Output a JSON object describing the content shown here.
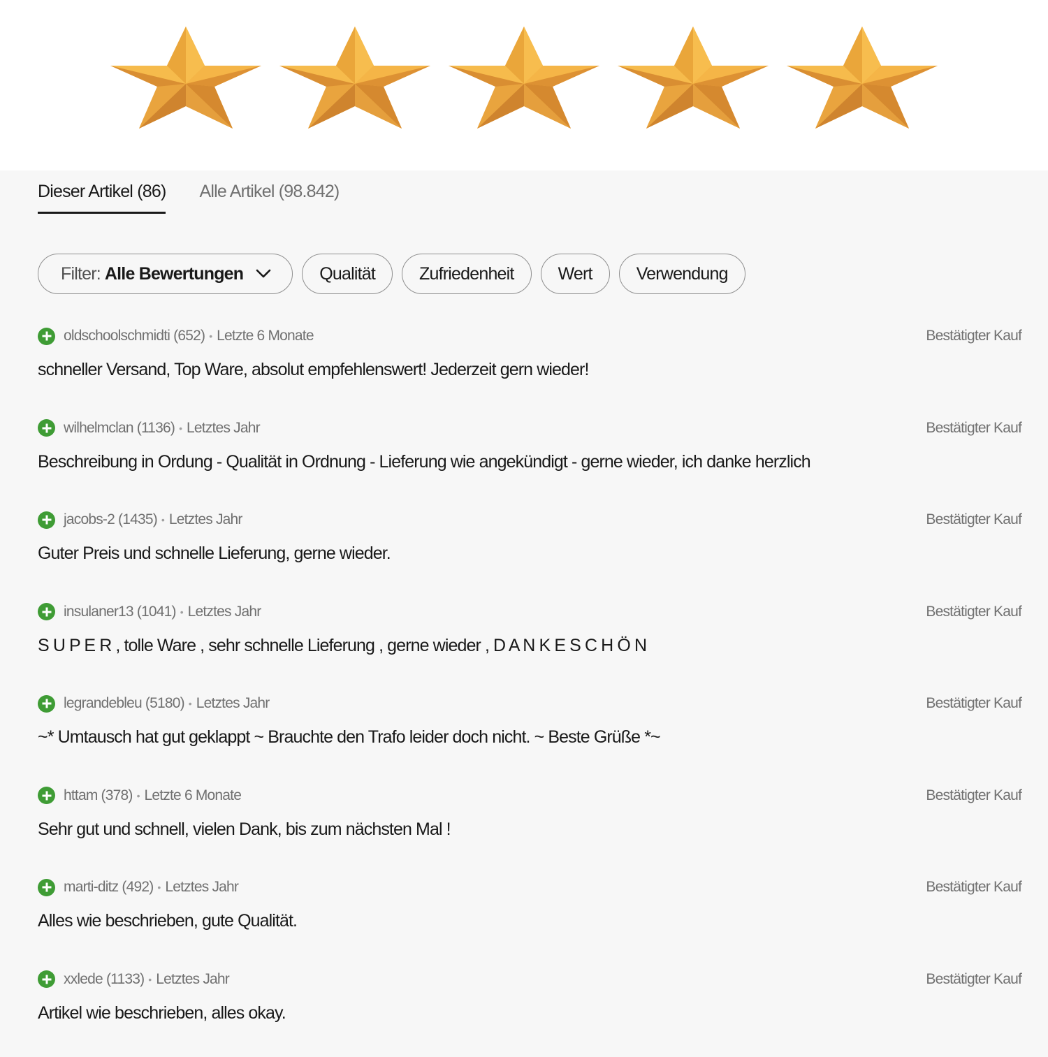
{
  "rating": {
    "stars": 5,
    "max": 5,
    "color": "#f0a93c"
  },
  "tabs": [
    {
      "label": "Dieser Artikel (86)",
      "active": true
    },
    {
      "label": "Alle Artikel (98.842)",
      "active": false
    }
  ],
  "filters": {
    "main": {
      "prefix": "Filter:",
      "value": "Alle Bewertungen",
      "icon": "chevron-down-icon"
    },
    "chips": [
      "Qualität",
      "Zufriedenheit",
      "Wert",
      "Verwendung"
    ]
  },
  "reviews": [
    {
      "user": "oldschoolschmidti (652)",
      "period": "Letzte 6 Monate",
      "badge": "Bestätigter Kauf",
      "text": "schneller Versand, Top Ware, absolut empfehlenswert! Jederzeit gern wieder!"
    },
    {
      "user": "wilhelmclan (1136)",
      "period": "Letztes Jahr",
      "badge": "Bestätigter Kauf",
      "text": "Beschreibung in Ordung - Qualität in Ordnung - Lieferung wie angekündigt - gerne wieder, ich danke herzlich"
    },
    {
      "user": "jacobs-2 (1435)",
      "period": "Letztes Jahr",
      "badge": "Bestätigter Kauf",
      "text": "Guter Preis und schnelle Lieferung, gerne wieder."
    },
    {
      "user": "insulaner13 (1041)",
      "period": "Letztes Jahr",
      "badge": "Bestätigter Kauf",
      "text": "S U P E R , tolle Ware , sehr schnelle Lieferung , gerne wieder , D A N K E S C H Ö N"
    },
    {
      "user": "legrandebleu (5180)",
      "period": "Letztes Jahr",
      "badge": "Bestätigter Kauf",
      "text": "~* Umtausch hat gut geklappt ~ Brauchte den Trafo leider doch nicht. ~ Beste Grüße *~"
    },
    {
      "user": "httam (378)",
      "period": "Letzte 6 Monate",
      "badge": "Bestätigter Kauf",
      "text": "Sehr gut und schnell, vielen Dank, bis zum nächsten Mal !"
    },
    {
      "user": "marti-ditz (492)",
      "period": "Letztes Jahr",
      "badge": "Bestätigter Kauf",
      "text": "Alles wie beschrieben, gute Qualität."
    },
    {
      "user": "xxlede (1133)",
      "period": "Letztes Jahr",
      "badge": "Bestätigter Kauf",
      "text": "Artikel wie beschrieben, alles okay."
    }
  ]
}
